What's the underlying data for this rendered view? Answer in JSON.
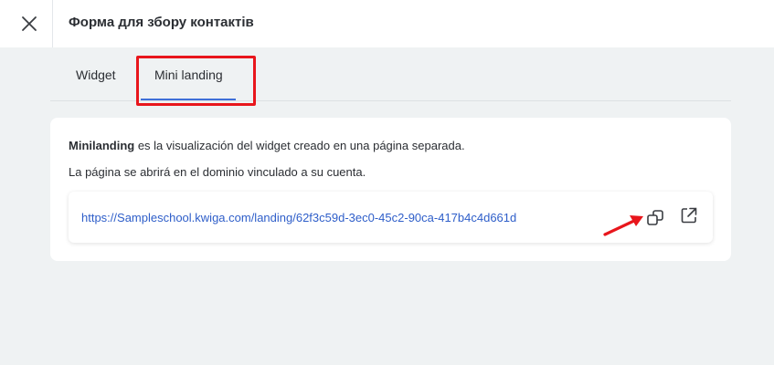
{
  "header": {
    "title": "Форма для збору контактів",
    "close_icon": "close-icon"
  },
  "tabs": [
    {
      "label": "Widget",
      "active": false
    },
    {
      "label": "Mini landing",
      "active": true
    }
  ],
  "card": {
    "description_bold": "Minilanding",
    "description_rest": " es la visualización del widget creado en una página separada.",
    "description_2": "La página se abrirá en el dominio vinculado a su cuenta.",
    "url": "https://Sampleschool.kwiga.com/landing/62f3c59d-3ec0-45c2-90ca-417b4c4d661d",
    "copy_icon": "copy-icon",
    "open_icon": "external-link-icon"
  },
  "colors": {
    "accent": "#3f6fd8",
    "link": "#2e5ec9",
    "annotation": "#e8161c",
    "background": "#eff2f3"
  }
}
